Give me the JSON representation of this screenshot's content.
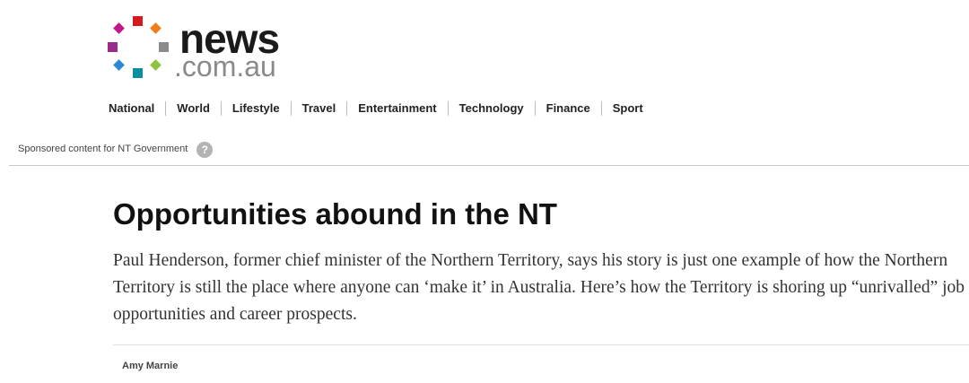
{
  "brand": {
    "name": "news",
    "domain_suffix": ".com.au",
    "dot_colors": [
      "#d41a1f",
      "#ef7d1a",
      "#8a8a8a",
      "#8ec43f",
      "#0c8fa0",
      "#2b89d4",
      "#9a2b8c",
      "#c2178a"
    ]
  },
  "nav": {
    "items": [
      "National",
      "World",
      "Lifestyle",
      "Travel",
      "Entertainment",
      "Technology",
      "Finance",
      "Sport"
    ]
  },
  "sponsored": {
    "text": "Sponsored content for NT Government",
    "help_icon": "question-circle-icon",
    "help_glyph": "?"
  },
  "article": {
    "headline": "Opportunities abound in the NT",
    "standfirst": "Paul Henderson, former chief minister of the Northern Territory, says his story is just one example of how the Northern Territory is still the place where anyone can ‘make it’ in Australia. Here’s how the Territory is shoring up “unrivalled” job opportunities and career prospects.",
    "author": "Amy Marnie"
  }
}
